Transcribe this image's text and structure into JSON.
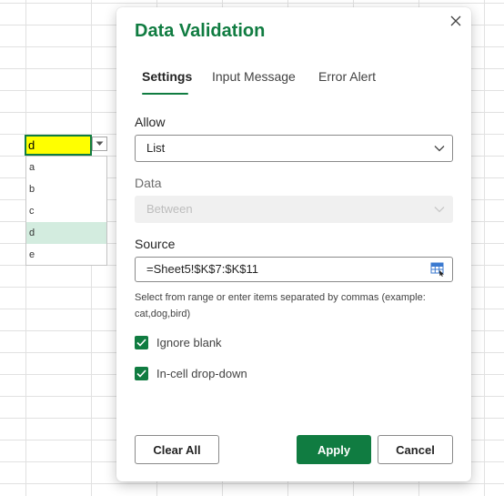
{
  "sheet": {
    "active_cell_value": "d",
    "dropdown_items": [
      "a",
      "b",
      "c",
      "d",
      "e"
    ],
    "selected_item": "d",
    "cell_fill_color": "#ffff00",
    "accent_color": "#107c41"
  },
  "dialog": {
    "title": "Data Validation",
    "close_icon": "close-icon",
    "tabs": [
      {
        "label": "Settings",
        "active": true
      },
      {
        "label": "Input Message",
        "active": false
      },
      {
        "label": "Error Alert",
        "active": false
      }
    ],
    "allow": {
      "label": "Allow",
      "value": "List"
    },
    "data": {
      "label": "Data",
      "value": "Between",
      "disabled": true
    },
    "source": {
      "label": "Source",
      "value": "=Sheet5!$K$7:$K$11",
      "icon": "range-select-icon"
    },
    "hint": "Select from range or enter items separated by commas (example: cat,dog,bird)",
    "checkboxes": [
      {
        "label": "Ignore blank",
        "checked": true
      },
      {
        "label": "In-cell drop-down",
        "checked": true
      }
    ],
    "buttons": {
      "clear_all": "Clear All",
      "apply": "Apply",
      "cancel": "Cancel"
    }
  }
}
